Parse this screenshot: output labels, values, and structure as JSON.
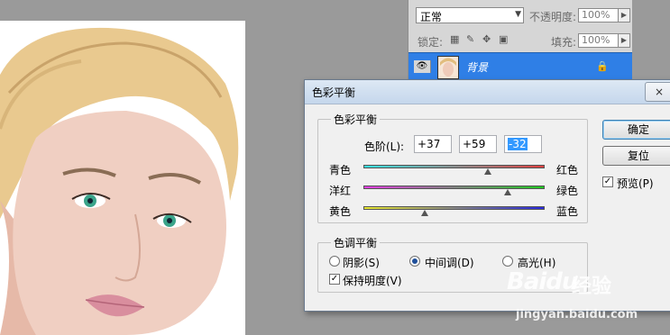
{
  "layers_panel": {
    "blend_mode": "正常",
    "opacity_label": "不透明度:",
    "opacity_value": "100%",
    "lock_label": "锁定:",
    "fill_label": "填充:",
    "fill_value": "100%",
    "layer_name": "背景"
  },
  "dialog": {
    "title": "色彩平衡",
    "close": "×",
    "color_balance_group": "色彩平衡",
    "levels_label": "色阶(L):",
    "level_values": [
      "+37",
      "+59",
      "-32"
    ],
    "sliders": [
      {
        "left": "青色",
        "right": "红色",
        "value": 37,
        "gradient": [
          "#37e3e3",
          "#e04040"
        ]
      },
      {
        "left": "洋红",
        "right": "绿色",
        "value": 59,
        "gradient": [
          "#e23ee2",
          "#22c822"
        ]
      },
      {
        "left": "黄色",
        "right": "蓝色",
        "value": -32,
        "gradient": [
          "#e8e830",
          "#2a2ae0"
        ]
      }
    ],
    "tone_group": "色调平衡",
    "tone_options": [
      "阴影(S)",
      "中间调(D)",
      "高光(H)"
    ],
    "tone_selected": "中间调(D)",
    "preserve_luminosity": "保持明度(V)",
    "preserve_checked": true,
    "ok_label": "确定",
    "reset_label": "复位",
    "preview_label": "预览(P)",
    "preview_checked": true
  },
  "watermark": {
    "logo": "Baidu",
    "sub": "经验",
    "url": "jingyan.baidu.com"
  }
}
